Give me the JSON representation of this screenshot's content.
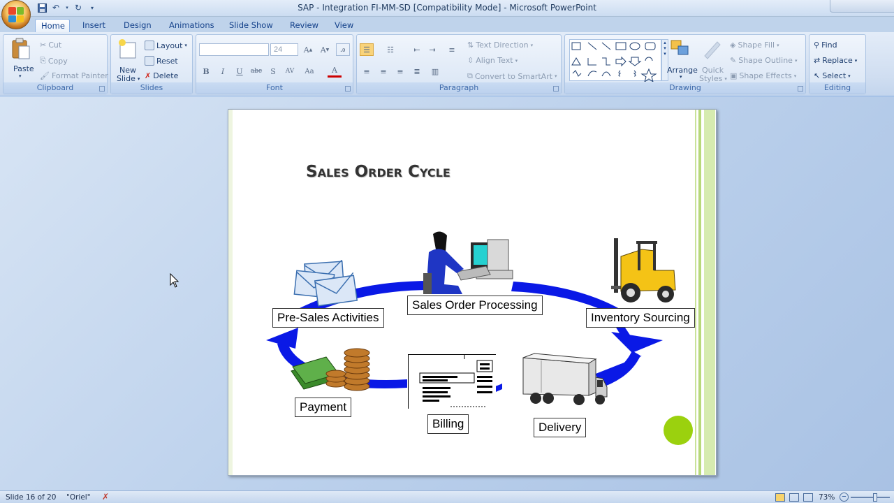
{
  "window": {
    "title": "SAP - Integration FI-MM-SD [Compatibility Mode] - Microsoft PowerPoint"
  },
  "tabs": [
    "Home",
    "Insert",
    "Design",
    "Animations",
    "Slide Show",
    "Review",
    "View"
  ],
  "ribbon": {
    "clipboard": {
      "label": "Clipboard",
      "paste": "Paste",
      "cut": "Cut",
      "copy": "Copy",
      "format_painter": "Format Painter"
    },
    "slides": {
      "label": "Slides",
      "new_slide_1": "New",
      "new_slide_2": "Slide",
      "layout": "Layout",
      "reset": "Reset",
      "delete": "Delete"
    },
    "font": {
      "label": "Font",
      "font_name": "",
      "font_size": "24"
    },
    "paragraph": {
      "label": "Paragraph",
      "text_direction": "Text Direction",
      "align_text": "Align Text",
      "convert_smartart": "Convert to SmartArt"
    },
    "drawing": {
      "label": "Drawing",
      "arrange": "Arrange",
      "quick_styles_1": "Quick",
      "quick_styles_2": "Styles",
      "shape_fill": "Shape Fill",
      "shape_outline": "Shape Outline",
      "shape_effects": "Shape Effects"
    },
    "editing": {
      "label": "Editing",
      "find": "Find",
      "replace": "Replace",
      "select": "Select"
    }
  },
  "slide": {
    "title": "Sales Order Cycle",
    "steps": {
      "pre_sales": "Pre-Sales Activities",
      "order": "Sales Order Processing",
      "inventory": "Inventory Sourcing",
      "payment": "Payment",
      "billing": "Billing",
      "delivery": "Delivery"
    }
  },
  "status": {
    "slide_info": "Slide 16 of 20",
    "theme": "\"Oriel\"",
    "zoom": "73%"
  },
  "colors": {
    "accent_green": "#9bd10e",
    "arrow_blue": "#0a19e6"
  }
}
